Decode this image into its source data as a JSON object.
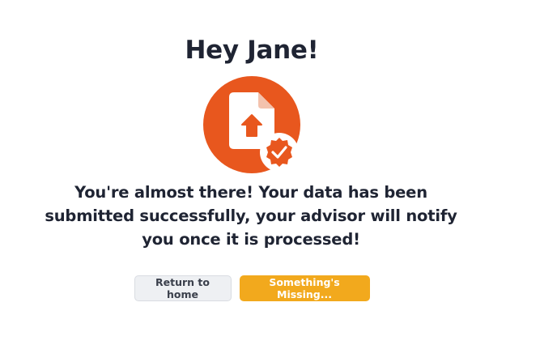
{
  "greeting": "Hey Jane!",
  "message": "You're almost there! Your data has been submitted successfully, your advisor will notify you once it is processed!",
  "actions": {
    "home_label": "Return to home",
    "missing_label": "Something's Missing..."
  },
  "icons": {
    "hero": "file-upload-icon",
    "badge": "verified-check-badge-icon"
  },
  "colors": {
    "accent": "#e8571e",
    "primary_button": "#f2a91d",
    "secondary_button": "#eef0f3",
    "text": "#1f2433"
  }
}
